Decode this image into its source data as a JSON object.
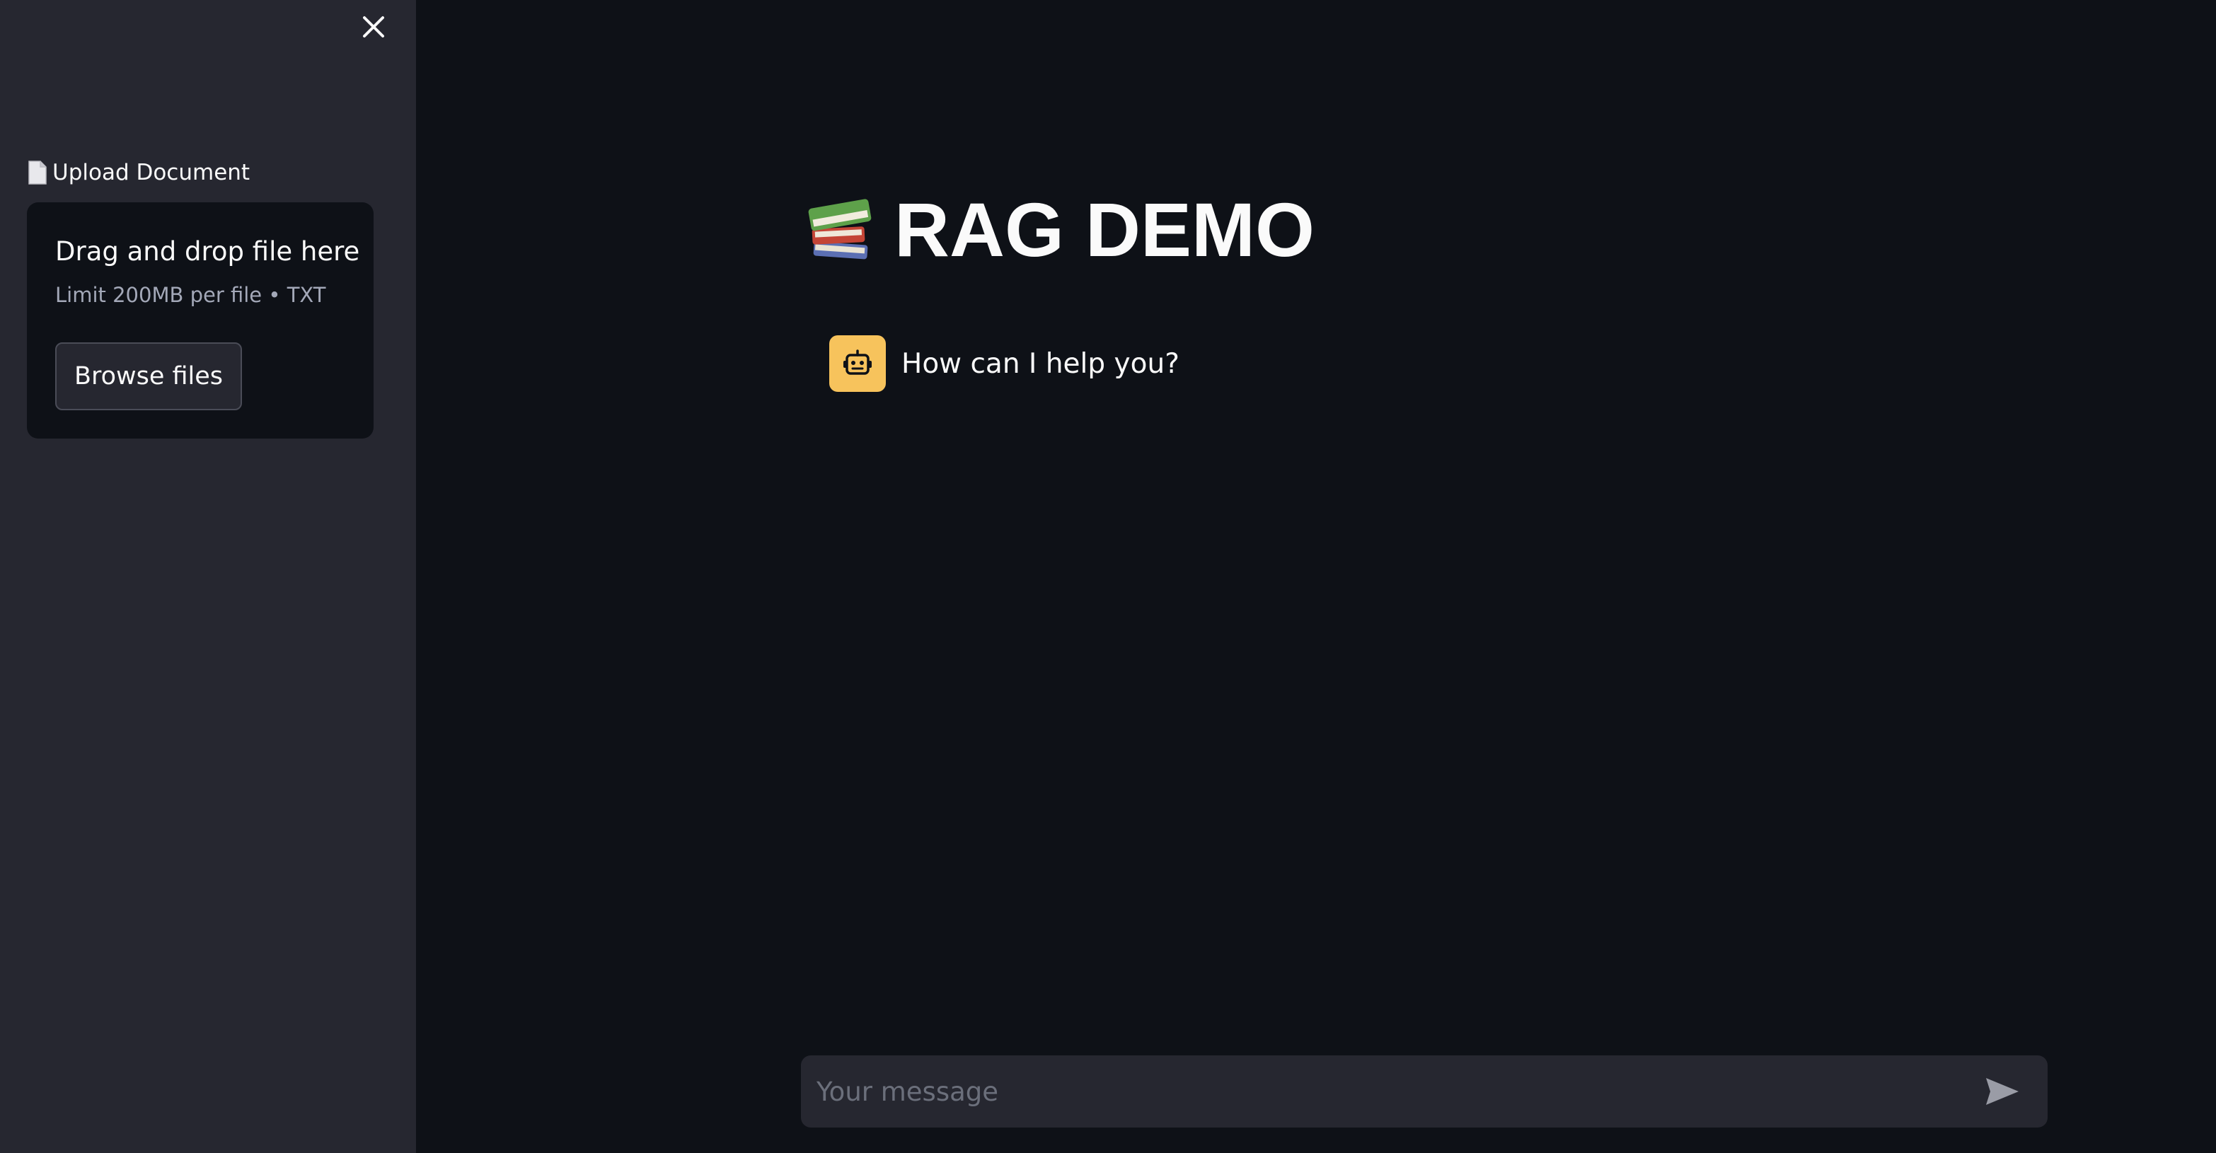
{
  "sidebar": {
    "close_icon": "close-icon",
    "upload_label": "Upload Document",
    "upload_icon": "document-icon",
    "dropzone": {
      "title": "Drag and drop file here",
      "limit": "Limit 200MB per file • TXT",
      "browse_label": "Browse files"
    }
  },
  "main": {
    "title_icon": "books-icon",
    "title": "RAG DEMO",
    "messages": [
      {
        "role": "assistant",
        "avatar_icon": "robot-icon",
        "text": "How can I help you?"
      }
    ],
    "chat_input": {
      "placeholder": "Your message",
      "value": "",
      "send_icon": "send-icon"
    }
  },
  "colors": {
    "sidebar_bg": "#262730",
    "main_bg": "#0e1117",
    "avatar_bg": "#f7c35c"
  }
}
